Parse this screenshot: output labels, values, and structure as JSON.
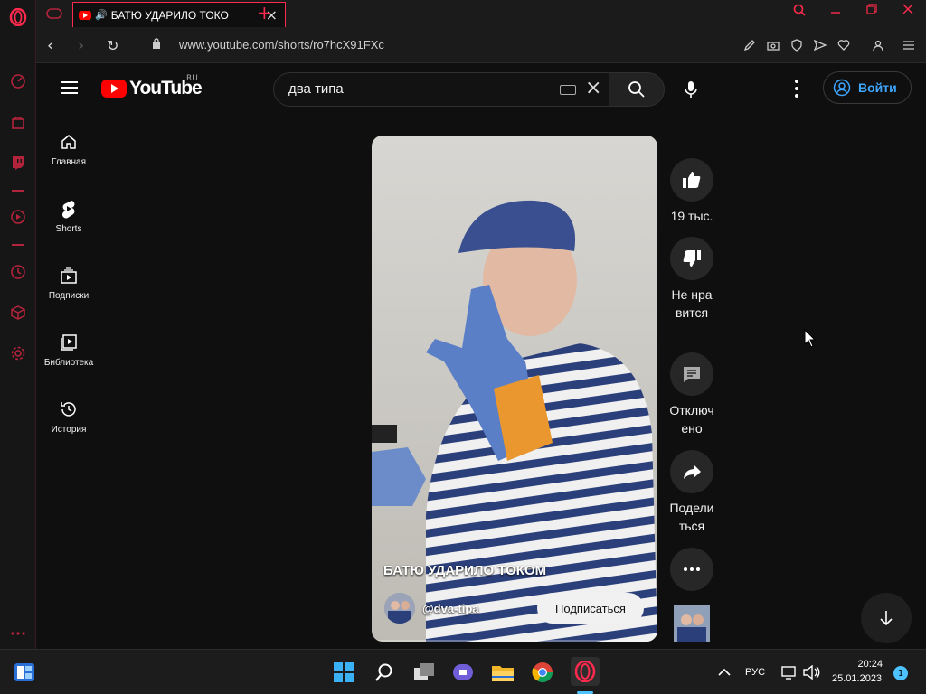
{
  "browser": {
    "tab_title": "БАТЮ УДАРИЛО ТОКО",
    "url": "www.youtube.com/shorts/ro7hcX91FXc"
  },
  "youtube": {
    "logo_text": "YouTube",
    "region": "RU",
    "search": {
      "query": "два типа"
    },
    "signin_label": "Войти",
    "nav": [
      {
        "label": "Главная",
        "icon": "home-icon"
      },
      {
        "label": "Shorts",
        "icon": "shorts-icon"
      },
      {
        "label": "Подписки",
        "icon": "subscriptions-icon"
      },
      {
        "label": "Библиотека",
        "icon": "library-icon"
      },
      {
        "label": "История",
        "icon": "history-icon"
      }
    ],
    "short": {
      "title": "БАТЮ УДАРИЛО ТОКОМ",
      "channel": "@dva-tipa",
      "subscribe_label": "Подписаться",
      "likes": "19 тыс.",
      "dislike_label": "Не нравится",
      "comments_label": "Отключено",
      "share_label": "Поделиться",
      "progress": 0.02
    }
  },
  "taskbar": {
    "lang": "РУС",
    "time": "20:24",
    "date": "25.01.2023",
    "notifications": "1"
  },
  "colors": {
    "accent": "#ff2a4d",
    "yt_red": "#ff0000",
    "link_blue": "#3ea6ff"
  }
}
